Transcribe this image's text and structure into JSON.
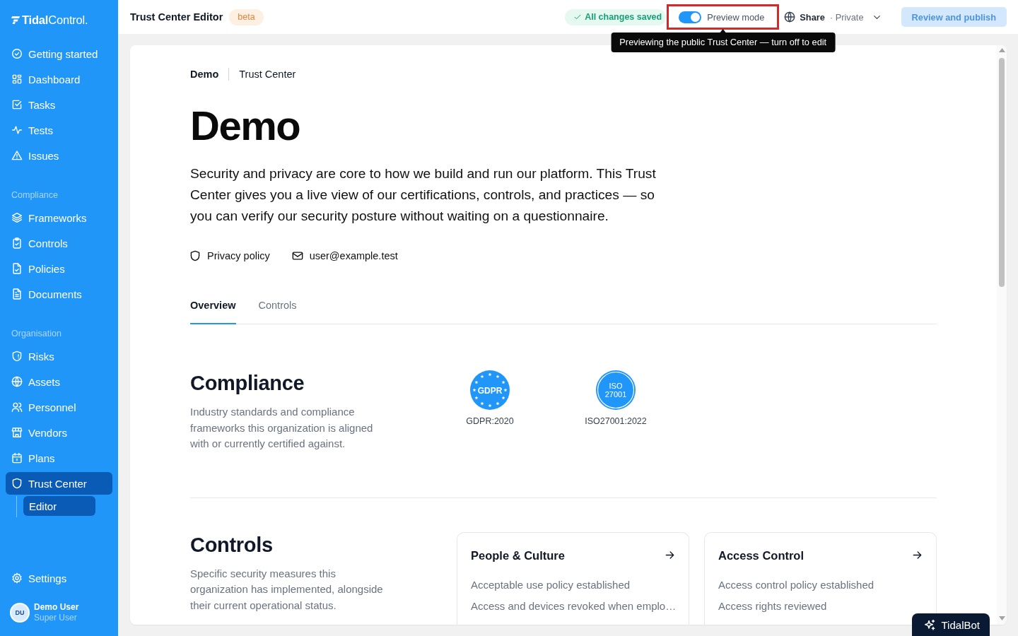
{
  "sidebar": {
    "logo": "**Tidal**Control.",
    "sections": [
      {
        "items": [
          {
            "label": "Getting started",
            "selected": false
          },
          {
            "label": "Dashboard",
            "selected": false
          },
          {
            "label": "Tasks",
            "selected": false
          },
          {
            "label": "Tests",
            "selected": false
          },
          {
            "label": "Issues",
            "selected": false
          }
        ]
      },
      {
        "heading": "Compliance",
        "items": [
          {
            "label": "Frameworks",
            "selected": false
          },
          {
            "label": "Controls",
            "selected": false
          },
          {
            "label": "Policies",
            "selected": false
          },
          {
            "label": "Documents",
            "selected": false
          }
        ]
      },
      {
        "heading": "Organisation",
        "items": [
          {
            "label": "Risks",
            "selected": false
          },
          {
            "label": "Assets",
            "selected": false
          },
          {
            "label": "Personnel",
            "selected": false
          },
          {
            "label": "Vendors",
            "selected": false
          },
          {
            "label": "Plans",
            "selected": false
          },
          {
            "label": "Trust Center",
            "selected": true,
            "children": [
              {
                "label": "Editor",
                "selected": true
              }
            ]
          }
        ]
      }
    ],
    "footer_items": [
      {
        "label": "Settings",
        "selected": false
      }
    ],
    "user": {
      "initials": "DU",
      "name": "Demo User",
      "role": "Super User"
    }
  },
  "topbar": {
    "title": "Trust Center Editor",
    "badge": "beta",
    "save_status": "All changes saved",
    "preview": {
      "label": "Preview mode",
      "on": true
    },
    "tooltip": "Previewing the public Trust Center — turn off to edit",
    "share": {
      "label": "Share",
      "visibility": "· Private"
    },
    "publish_button": {
      "label": "Review and publish",
      "disabled": true
    }
  },
  "page": {
    "breadcrumb": [
      "Demo",
      "Trust Center"
    ],
    "title": "Demo",
    "intro": "Security and privacy are core to how we build and run our platform. This Trust Center gives you a live view of our certifications, controls, and practices — so you can verify our security posture without waiting on a questionnaire.",
    "links": [
      {
        "kind": "privacy",
        "label": "Privacy policy"
      },
      {
        "kind": "email",
        "label": "user@example.test"
      }
    ],
    "tabs": [
      {
        "label": "Overview",
        "selected": true
      },
      {
        "label": "Controls",
        "selected": false
      }
    ]
  },
  "compliance": {
    "title": "Compliance",
    "description": "Industry standards and compliance frameworks this organization is aligned with or currently certified against.",
    "frameworks": [
      {
        "kind": "gdpr",
        "seal_text": [
          "GDPR"
        ],
        "label": "GDPR:2020"
      },
      {
        "kind": "iso",
        "seal_text": [
          "ISO",
          "27001"
        ],
        "label": "ISO27001:2022"
      }
    ]
  },
  "controls": {
    "title": "Controls",
    "description": "Specific security measures this organization has implemented, alongside their current operational status.",
    "categories": [
      {
        "title": "People & Culture",
        "items": [
          "Acceptable use policy established",
          "Access and devices revoked when emplo…"
        ]
      },
      {
        "title": "Access Control",
        "items": [
          "Access control policy established",
          "Access rights reviewed"
        ]
      }
    ]
  },
  "assistant": {
    "label": "TidalBot"
  }
}
